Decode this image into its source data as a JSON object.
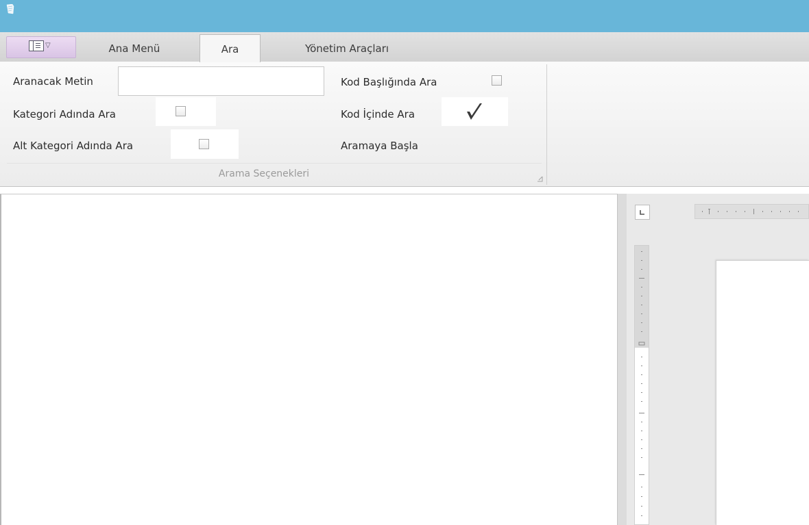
{
  "tabs": [
    {
      "label": "Ana Menü"
    },
    {
      "label": "Ara"
    },
    {
      "label": "Yönetim Araçları"
    }
  ],
  "active_tab": "Ara",
  "search": {
    "text_label": "Aranacak Metin",
    "text_value": "",
    "category_name_label": "Kategori Adında Ara",
    "category_name_checked": false,
    "sub_category_name_label": "Alt Kategori Adında Ara",
    "sub_category_name_checked": false,
    "code_title_label": "Kod Başlığında Ara",
    "code_title_checked": false,
    "code_content_label": "Kod İçinde Ara",
    "code_content_checked": true,
    "start_label": "Aramaya Başla",
    "group_caption": "Arama Seçenekleri"
  },
  "colors": {
    "titlebar": "#68b6d9",
    "app_menu_button": "#e3d0ec"
  },
  "icons": {
    "app": "app-icon",
    "app_menu": "app-menu-icon",
    "launcher": "dialog-launcher-icon",
    "check": "checkmark-icon",
    "tab_stop": "tab-stop-icon"
  }
}
